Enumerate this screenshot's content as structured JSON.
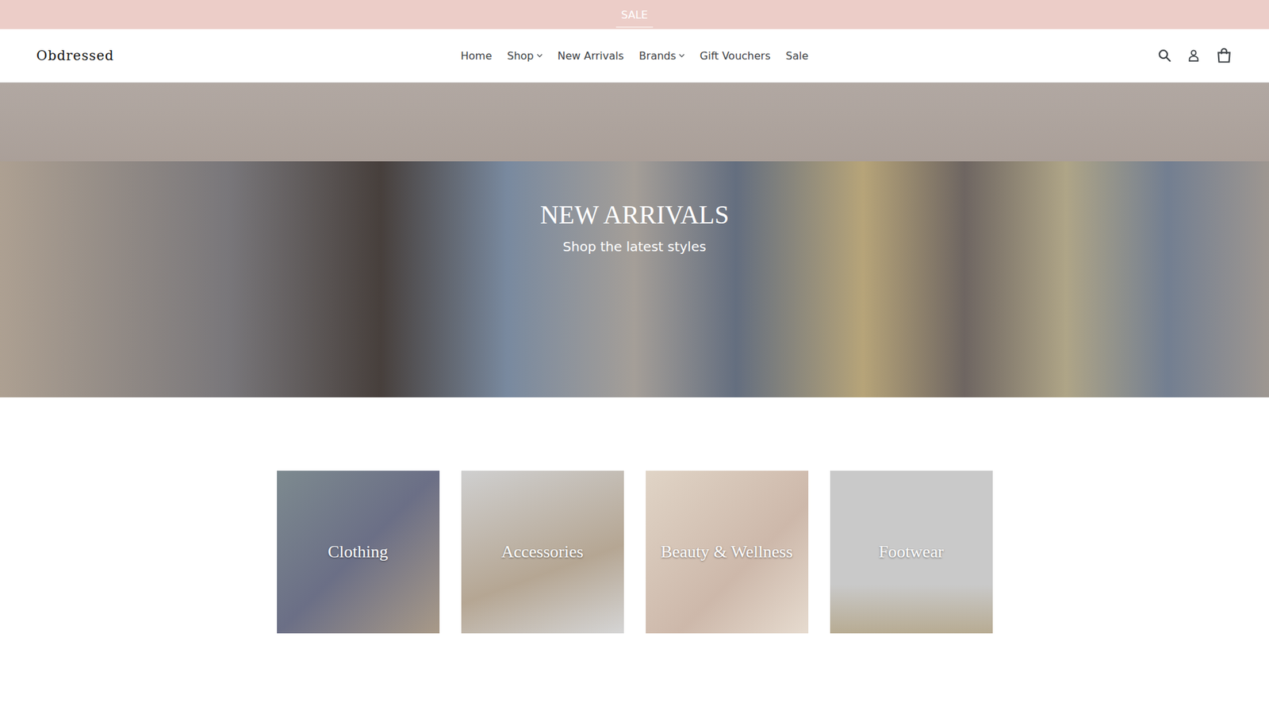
{
  "announcement": {
    "text": "SALE"
  },
  "header": {
    "logo": "Obdressed",
    "nav": [
      {
        "label": "Home",
        "dropdown": false
      },
      {
        "label": "Shop",
        "dropdown": true
      },
      {
        "label": "New Arrivals",
        "dropdown": false
      },
      {
        "label": "Brands",
        "dropdown": true
      },
      {
        "label": "Gift Vouchers",
        "dropdown": false
      },
      {
        "label": "Sale",
        "dropdown": false
      }
    ]
  },
  "hero": {
    "title": "NEW ARRIVALS",
    "subtitle": "Shop the latest styles"
  },
  "categories": [
    {
      "label": "Clothing"
    },
    {
      "label": "Accessories"
    },
    {
      "label": "Beauty & Wellness"
    },
    {
      "label": "Footwear"
    }
  ]
}
